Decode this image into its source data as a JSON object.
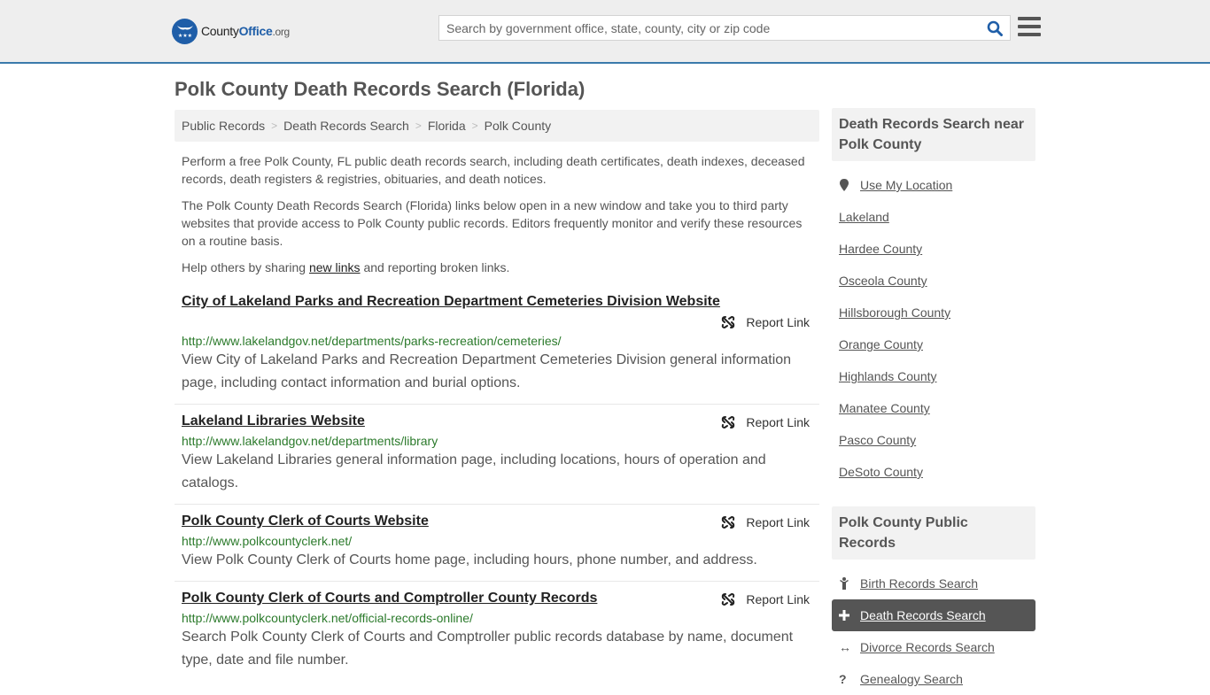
{
  "header": {
    "logo": {
      "name": "County",
      "brand": "Office",
      "tld": ".org"
    },
    "search": {
      "placeholder": "Search by government office, state, county, city or zip code",
      "value": ""
    }
  },
  "page": {
    "title": "Polk County Death Records Search (Florida)",
    "breadcrumb": [
      "Public Records",
      "Death Records Search",
      "Florida",
      "Polk County"
    ],
    "intro": {
      "p1": "Perform a free Polk County, FL public death records search, including death certificates, death indexes, deceased records, death registers & registries, obituaries, and death notices.",
      "p2": "The Polk County Death Records Search (Florida) links below open in a new window and take you to third party websites that provide access to Polk County public records. Editors frequently monitor and verify these resources on a routine basis.",
      "p3_before": "Help others by sharing ",
      "p3_link": "new links",
      "p3_after": " and reporting broken links."
    },
    "report_label": "Report Link",
    "results": [
      {
        "title": "City of Lakeland Parks and Recreation Department Cemeteries Division Website",
        "url": "http://www.lakelandgov.net/departments/parks-recreation/cemeteries/",
        "description": "View City of Lakeland Parks and Recreation Department Cemeteries Division general information page, including contact information and burial options."
      },
      {
        "title": "Lakeland Libraries Website",
        "url": "http://www.lakelandgov.net/departments/library",
        "description": "View Lakeland Libraries general information page, including locations, hours of operation and catalogs."
      },
      {
        "title": "Polk County Clerk of Courts Website",
        "url": "http://www.polkcountyclerk.net/",
        "description": "View Polk County Clerk of Courts home page, including hours, phone number, and address."
      },
      {
        "title": "Polk County Clerk of Courts and Comptroller County Records",
        "url": "http://www.polkcountyclerk.net/official-records-online/",
        "description": "Search Polk County Clerk of Courts and Comptroller public records database by name, document type, date and file number."
      }
    ]
  },
  "sidebar": {
    "nearby": {
      "heading": "Death Records Search near Polk County",
      "use_location": "Use My Location",
      "items": [
        "Lakeland",
        "Hardee County",
        "Osceola County",
        "Hillsborough County",
        "Orange County",
        "Highlands County",
        "Manatee County",
        "Pasco County",
        "DeSoto County"
      ]
    },
    "public_records": {
      "heading": "Polk County Public Records",
      "items": [
        {
          "label": "Birth Records Search",
          "icon": "child-icon"
        },
        {
          "label": "Death Records Search",
          "icon": "plus-icon",
          "active": true
        },
        {
          "label": "Divorce Records Search",
          "icon": "arrows-horizontal-icon"
        },
        {
          "label": "Genealogy Search",
          "icon": "question-icon"
        }
      ]
    }
  }
}
